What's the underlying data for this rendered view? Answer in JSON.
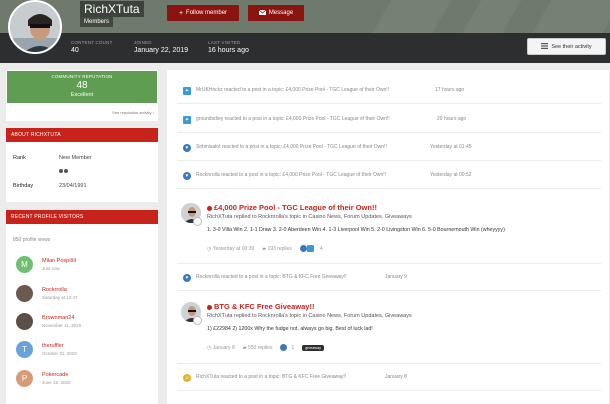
{
  "header": {
    "username": "RichXTuta",
    "group": "Members",
    "follow_label": "Follow member",
    "message_label": "Message",
    "activity_label": "See their activity",
    "stats": [
      {
        "label": "CONTENT COUNT",
        "value": "40"
      },
      {
        "label": "JOINED",
        "value": "January 22, 2019"
      },
      {
        "label": "LAST VISITED",
        "value": "16 hours ago"
      }
    ]
  },
  "reputation": {
    "title": "COMMUNITY REPUTATION",
    "value": "48",
    "level": "Excellent",
    "link": "See reputation activity"
  },
  "about": {
    "title": "ABOUT RICHXTUTA",
    "rank_label": "Rank",
    "rank_value": "New Member",
    "birthday_label": "Birthday",
    "birthday_value": "23/04/1991"
  },
  "visitors": {
    "title": "RECENT PROFILE VISITORS",
    "views": "850 profile views",
    "items": [
      {
        "name": "Milan Pospíšil",
        "time": "Just now",
        "initial": "M",
        "color": "#6cc070"
      },
      {
        "name": "Rockrrolla",
        "time": "Saturday at 13:47",
        "initial": "",
        "color": "#6b5a50"
      },
      {
        "name": "Brownman24",
        "time": "November 11, 2020",
        "initial": "",
        "color": "#5a5048"
      },
      {
        "name": "theruffler",
        "time": "October 31, 2020",
        "initial": "T",
        "color": "#6aa3d8"
      },
      {
        "name": "Pokercade",
        "time": "June 18, 2020",
        "initial": "P",
        "color": "#d79b78"
      }
    ]
  },
  "feed": {
    "small": [
      {
        "text": "MrUKHockz reacted to a post in a topic: £4,000 Prize Pool - TGC League of their Own!!",
        "time": "17 hours ago",
        "icon": "thanks-icon",
        "color": "#3b9ad1"
      },
      {
        "text": "groundsdiey reacted to a post in a topic: £4,000 Prize Pool - TGC League of their Own!!",
        "time": "20 hours ago",
        "icon": "thanks-icon",
        "color": "#3b9ad1"
      },
      {
        "text": "Sirbinisalot reacted to a post in a topic: £4,000 Prize Pool - TGC League of their Own!!",
        "time": "Yesterday at 01:45",
        "icon": "like-icon",
        "color": "#3b78c2"
      },
      {
        "text": "Rocknrolla reacted to a post in a topic: £4,000 Prize Pool - TGC League of their Own!!",
        "time": "Yesterday at 00:52",
        "icon": "like-icon",
        "color": "#3b78c2"
      },
      {
        "text": "Rocknrolla reacted to a post in a topic: BTG & KFC Free Giveaway!!",
        "time": "January 9",
        "icon": "like-icon",
        "color": "#3b78c2"
      },
      {
        "text": "RichXTuta reacted to a post in a topic: BTG & KFC Free Giveaway!!",
        "time": "January 8",
        "icon": "haha-icon",
        "color": "#e6b422"
      }
    ],
    "posts": [
      {
        "title": "£4,000 Prize Pool - TGC League of their Own!!",
        "sub": "RichXTuta replied to Rocknrolla's topic in Casino News, Forum Updates, Giveaways",
        "body": "1. 3-0 Villa Win 2. 1-1 Draw 3. 2-0 Aberdeen Win 4. 1-3 Liverpool Win 5. 2-0 Livingston Win 6. 5-0 Bournemouth Win (wheyyyy)",
        "time": "Yesterday at 00:39",
        "replies": "193 replies",
        "reactions": "4",
        "tag": ""
      },
      {
        "title": "BTG & KFC Free Giveaway!!",
        "sub": "RichXTuta replied to Rocknrolla's topic in Casino News, Forum Updates, Giveaways",
        "body": "1) £22984 2) 1200x Why the fudge not, always go big. Best of luck lad!",
        "time": "January 8",
        "replies": "550 replies",
        "reactions": "1",
        "tag": "giveaway"
      }
    ]
  }
}
